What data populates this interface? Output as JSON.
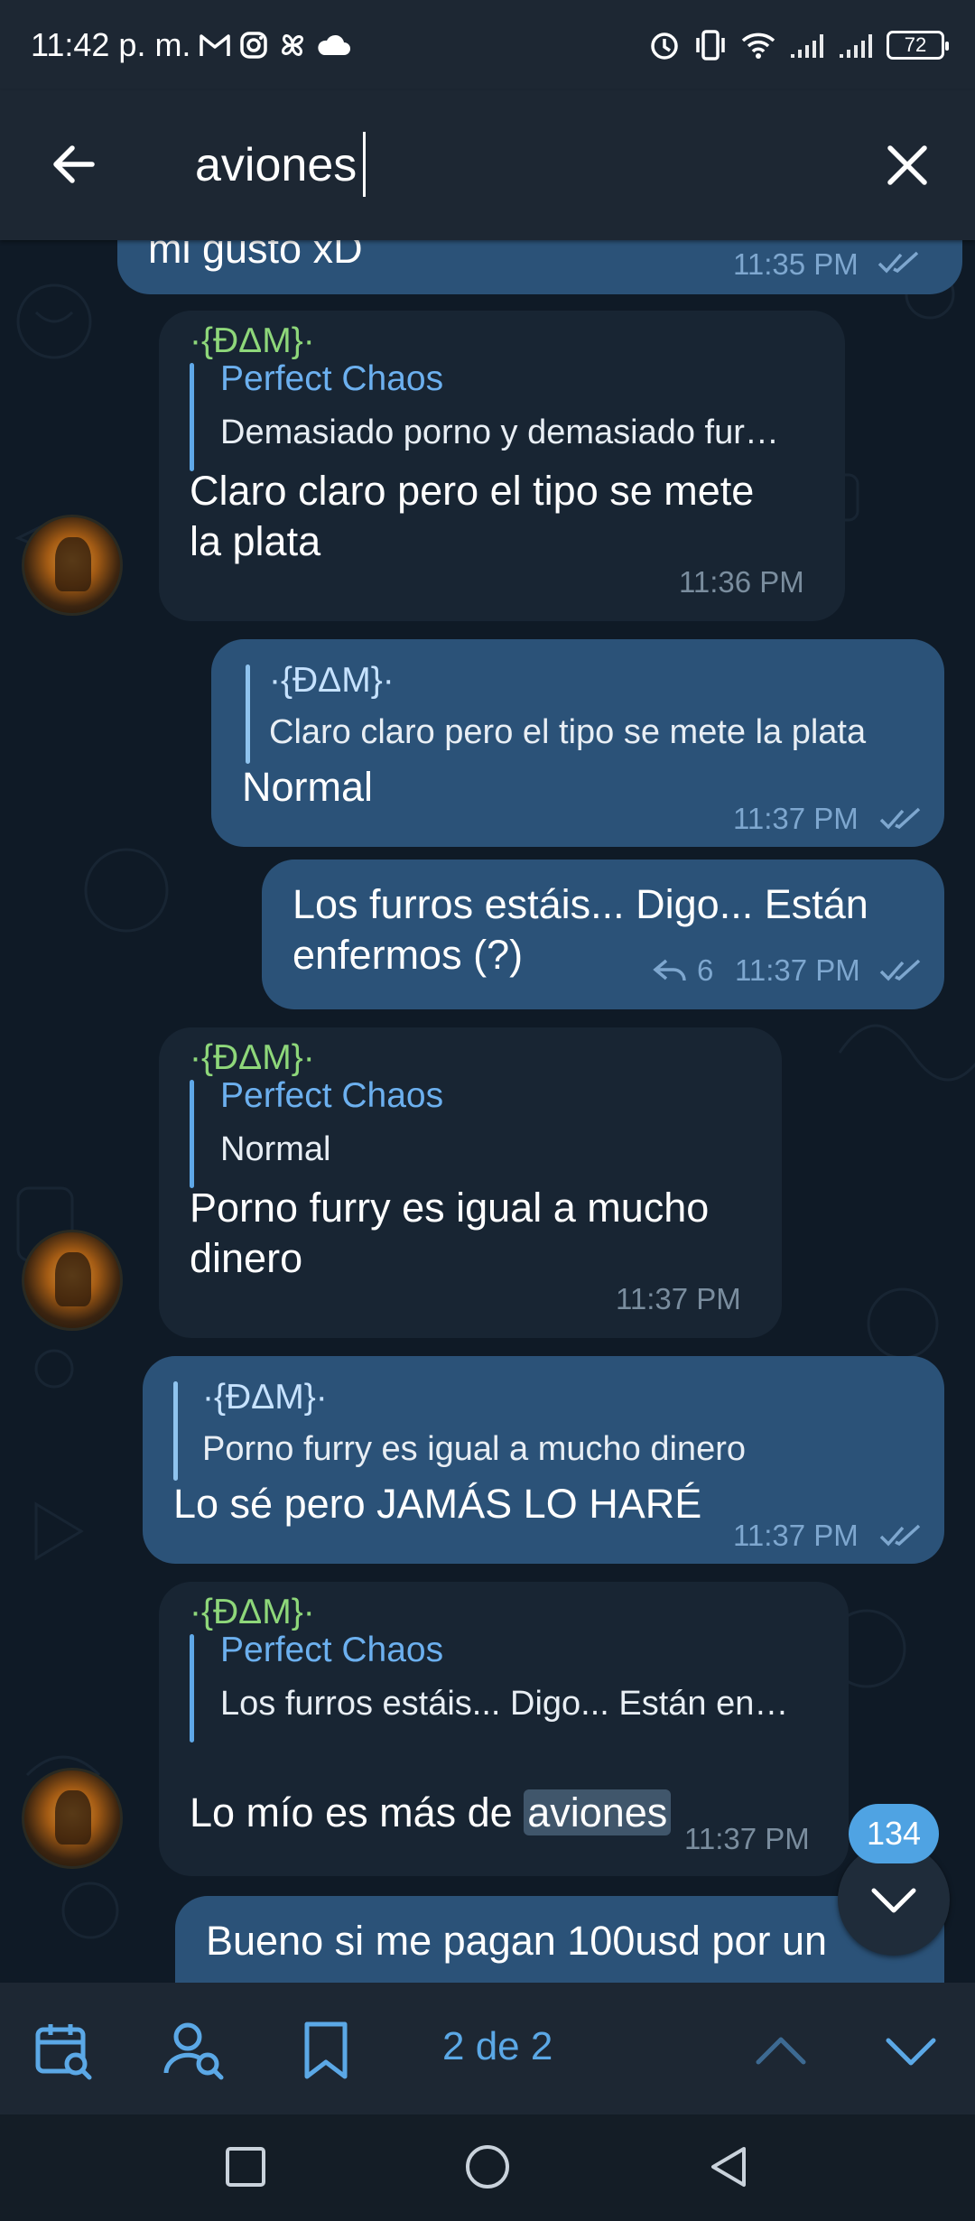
{
  "status_bar": {
    "time": "11:42 p. m.",
    "battery": "72",
    "left_icons": [
      "gmail-icon",
      "instagram-icon",
      "pinwheel-icon",
      "cloud-icon"
    ],
    "right_icons": [
      "alarm-icon",
      "vibrate-icon",
      "wifi-icon",
      "signal-icon",
      "signal-icon",
      "battery-icon"
    ]
  },
  "header": {
    "back_icon": "arrow-left-icon",
    "search_value": "aviones",
    "close_icon": "close-icon"
  },
  "messages": [
    {
      "id": "m0",
      "direction": "out",
      "text": "mi gusto xD",
      "time": "11:35 PM",
      "read": true
    },
    {
      "id": "m1",
      "direction": "in",
      "sender": "·{ĐΔM}·",
      "reply_name": "Perfect Chaos",
      "reply_text": "Demasiado porno y demasiado fur…",
      "text": "Claro claro pero el tipo se mete\nla plata",
      "time": "11:36 PM"
    },
    {
      "id": "m2",
      "direction": "out",
      "reply_name": "·{ĐΔM}·",
      "reply_text": "Claro claro pero el tipo se mete la plata",
      "text": "Normal",
      "time": "11:37 PM",
      "read": true
    },
    {
      "id": "m3",
      "direction": "out",
      "text": "Los furros estáis... Digo... Están\nenfermos (?)",
      "reply_count": "6",
      "time": "11:37 PM",
      "read": true
    },
    {
      "id": "m4",
      "direction": "in",
      "sender": "·{ĐΔM}·",
      "reply_name": "Perfect Chaos",
      "reply_text": "Normal",
      "text": "Porno furry es igual a mucho\ndinero",
      "time": "11:37 PM"
    },
    {
      "id": "m5",
      "direction": "out",
      "reply_name": "·{ĐΔM}·",
      "reply_text": "Porno furry es igual a mucho dinero",
      "text": "Lo sé pero JAMÁS LO HARÉ",
      "time": "11:37 PM",
      "read": true
    },
    {
      "id": "m6",
      "direction": "in",
      "sender": "·{ĐΔM}·",
      "reply_name": "Perfect Chaos",
      "reply_text": "Los furros estáis... Digo... Están en…",
      "text_before": "Lo mío es más de ",
      "text_highlight": "aviones",
      "time": "11:37 PM"
    },
    {
      "id": "m7",
      "direction": "out",
      "text": "Bueno si me pagan 100usd por un"
    }
  ],
  "scroll_down": {
    "unread_count": "134",
    "icon": "chevron-down-icon"
  },
  "search_bar": {
    "calendar_icon": "calendar-search-icon",
    "user_icon": "user-search-icon",
    "bookmark_icon": "bookmark-icon",
    "result_count": "2 de 2",
    "up_icon": "chevron-up-icon",
    "down_icon": "chevron-down-icon"
  },
  "nav": {
    "icons": [
      "square-recents-icon",
      "circle-home-icon",
      "triangle-back-icon"
    ]
  },
  "colors": {
    "header_bg": "#1d2733",
    "chat_bg": "#0f1a26",
    "outgoing_bubble": "#2b5278",
    "incoming_bubble": "#182533",
    "sender_green": "#8ed77a",
    "accent_blue": "#5ba8e6"
  }
}
